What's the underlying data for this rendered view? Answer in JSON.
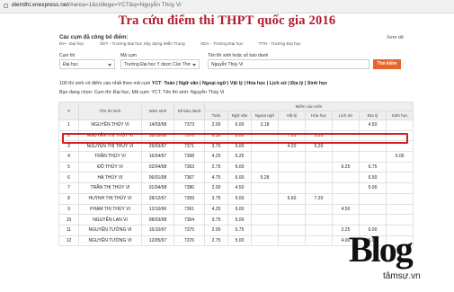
{
  "browser": {
    "url_host": "diemthi.vnexpress.net",
    "url_path": "/#area=1&college=YCT&q=Nguyễn Thúy Vi"
  },
  "page": {
    "title": "Tra cứu điểm thi THPT quốc gia 2016"
  },
  "clusters": {
    "label": "Các cụm đã công bố điểm:",
    "view_all": "Xem tất",
    "legend": [
      "ĐH - Đại học",
      "XDT - Trường Đại học Xây dựng Miền Trung",
      "XDA - Trường Đại học",
      "TTN - Trường Đại học"
    ]
  },
  "search": {
    "cluster_label": "Cụm thi",
    "cluster_value": "Đại học",
    "code_label": "Mã cụm",
    "code_value": "Trường Đại học Y dược Cần Thơ",
    "name_label": "Tên thí sinh hoặc số báo danh",
    "name_value": "Nguyễn Thúy Vi",
    "button": "Tìm kiếm"
  },
  "results": {
    "summary_prefix": "100 thí sinh có điểm cao nhất theo mã cụm",
    "summary_code": "YCT",
    "summary_links": "Toán | Ngữ văn | Ngoại ngữ | Vật lý | Hóa học | Lịch sử | Địa lý | Sinh học",
    "filter_text": "Bạn đang chọn: Cụm thi: Đại học, Mã cụm: YCT, Tên thí sinh: Nguyễn Thúy Vi"
  },
  "table": {
    "headers": [
      "#",
      "Tên thí sinh",
      "Năm sinh",
      "Số báo danh",
      "Toán",
      "Ngữ văn",
      "Ngoại ngữ",
      "Vật lý",
      "Hóa học",
      "Lịch sử",
      "Địa lý",
      "Sinh học"
    ],
    "group_header": "Điểm các môn",
    "rows": [
      [
        "1",
        "NGUYỄN THÚY VI",
        "14/03/98",
        "7373",
        "2.00",
        "6.00",
        "3.18",
        "",
        "",
        "",
        "4.50",
        ""
      ],
      [
        "2",
        "NGUYỄN THỊ THÚY VI",
        "18/10/98",
        "7370",
        "6.50",
        "8.00",
        "",
        "7.20",
        "5.20",
        "",
        "",
        ""
      ],
      [
        "3",
        "NGUYỄN THỊ THÚY VI",
        "29/03/97",
        "7371",
        "3.75",
        "5.00",
        "",
        "4.20",
        "5.20",
        "",
        "",
        ""
      ],
      [
        "4",
        "TRẦN THÚY VI",
        "16/04/97",
        "7368",
        "4.25",
        "5.25",
        "",
        "",
        "",
        "",
        "",
        "5.00"
      ],
      [
        "5",
        "ĐỖ THÚY VI",
        "02/04/98",
        "7363",
        "2.75",
        "6.00",
        "",
        "",
        "",
        "6.25",
        "6.75",
        ""
      ],
      [
        "6",
        "HÀ THÚY VI",
        "06/01/98",
        "7367",
        "4.75",
        "6.00",
        "5.28",
        "",
        "",
        "",
        "6.50",
        ""
      ],
      [
        "7",
        "TRẦN THỊ THÚY VI",
        "01/04/98",
        "7386",
        "2.00",
        "4.50",
        "",
        "",
        "",
        "",
        "5.00",
        ""
      ],
      [
        "8",
        "HUỲNH THỊ THÚY VI",
        "28/12/97",
        "7359",
        "3.75",
        "5.00",
        "",
        "5.60",
        "7.20",
        "",
        "",
        ""
      ],
      [
        "9",
        "PHẠM THỊ THÚY VI",
        "12/10/96",
        "7361",
        "4.25",
        "6.00",
        "",
        "",
        "",
        "4.50",
        "",
        ""
      ],
      [
        "10",
        "NGUYỄN LAN VI",
        "08/03/98",
        "7364",
        "3.75",
        "5.00",
        "",
        "",
        "",
        "",
        "",
        ""
      ],
      [
        "11",
        "NGUYỄN TƯỜNG VI",
        "16/10/97",
        "7375",
        "2.00",
        "5.75",
        "",
        "",
        "",
        "2.25",
        "6.00",
        ""
      ],
      [
        "12",
        "NGUYỄN TƯỜNG VI",
        "12/05/97",
        "7376",
        "2.75",
        "5.00",
        "",
        "",
        "",
        "4.00",
        "6.00",
        ""
      ]
    ]
  },
  "watermark": {
    "brand": "Blog",
    "site": "tâmsự.vn"
  },
  "colors": {
    "title": "#b31b2b",
    "button": "#e8662e",
    "highlight": "#d21f1f"
  }
}
